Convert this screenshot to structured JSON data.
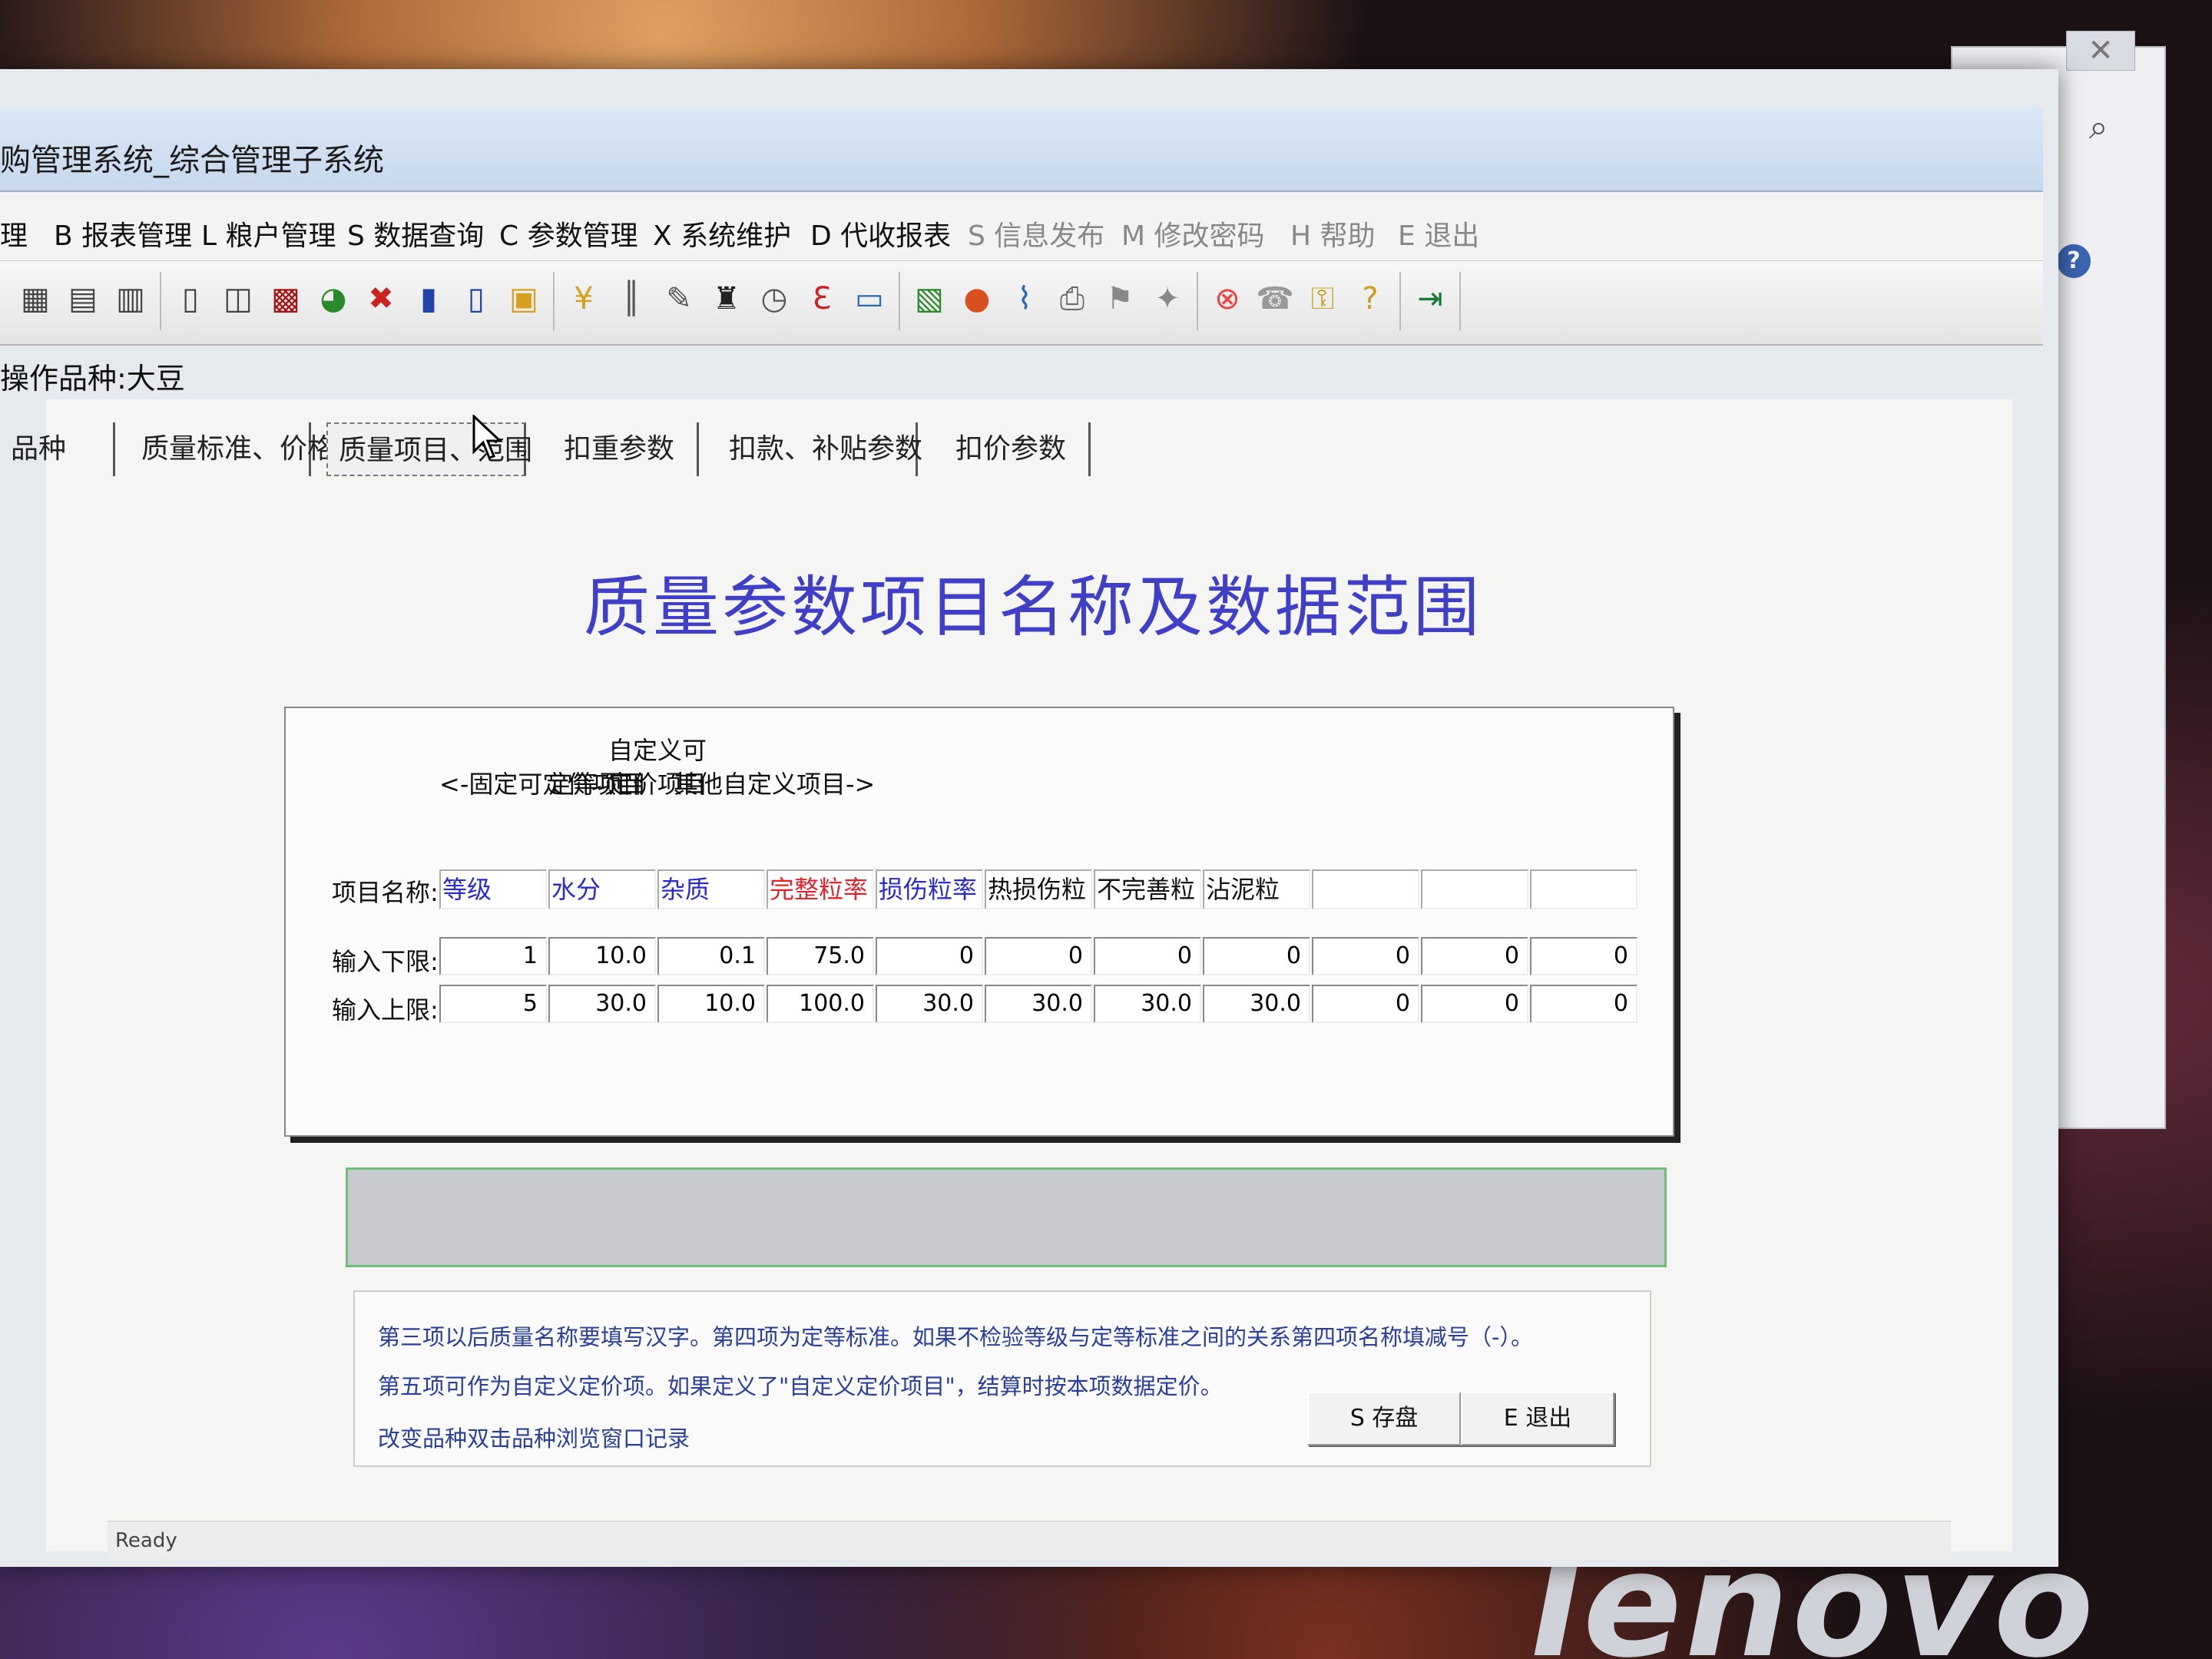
{
  "window": {
    "title": "购管理系统_综合管理子系统"
  },
  "menu": [
    {
      "label": "理",
      "dim": false
    },
    {
      "label": "B 报表管理",
      "dim": false
    },
    {
      "label": "L 粮户管理",
      "dim": false
    },
    {
      "label": "S 数据查询",
      "dim": false
    },
    {
      "label": "C 参数管理",
      "dim": false
    },
    {
      "label": "X 系统维护",
      "dim": false
    },
    {
      "label": "D 代收报表",
      "dim": false
    },
    {
      "label": "S 信息发布",
      "dim": true
    },
    {
      "label": "M 修改密码",
      "dim": true
    },
    {
      "label": "H 帮助",
      "dim": true
    },
    {
      "label": "E 退出",
      "dim": true
    }
  ],
  "toolbar_icons": [
    "grid-icon",
    "report-icon",
    "document-icon",
    "columns-icon",
    "layout-icon",
    "table-icon",
    "pie-chart-icon",
    "excel-icon",
    "bar-chart-icon",
    "bar-chart-2-icon",
    "image-icon",
    "money-icon",
    "barcode-icon",
    "tool-icon",
    "binoculars-icon",
    "clock-icon",
    "e-icon",
    "window-icon",
    "picture-icon",
    "group-icon",
    "chart-icon",
    "printer-icon",
    "flag-icon",
    "run-icon",
    "stop-icon",
    "phone-icon",
    "key-icon",
    "help-icon",
    "exit-icon"
  ],
  "operating_variety": "操作品种:大豆",
  "tabs": [
    {
      "label": "品种",
      "active": false
    },
    {
      "label": "质量标准、价格",
      "active": false
    },
    {
      "label": "质量项目、范围",
      "active": true
    },
    {
      "label": "扣重参数",
      "active": false
    },
    {
      "label": "扣款、补贴参数",
      "active": false
    },
    {
      "label": "扣价参数",
      "active": false
    }
  ],
  "heading": "质量参数项目名称及数据范围",
  "groups": {
    "fixed": "<-固定可定价项目",
    "grade": "定等项目",
    "custom_top": "自定义可",
    "custom_bottom": "定价项目",
    "others": "其他自定义项目->"
  },
  "labels": {
    "name": "项目名称:",
    "lower": "输入下限:",
    "upper": "输入上限:"
  },
  "items": [
    {
      "name": "等级",
      "color": "#2a2ad0",
      "lower": "1",
      "upper": "5"
    },
    {
      "name": "水分",
      "color": "#2a2ad0",
      "lower": "10.0",
      "upper": "30.0"
    },
    {
      "name": "杂质",
      "color": "#2a2ad0",
      "lower": "0.1",
      "upper": "10.0"
    },
    {
      "name": "完整粒率",
      "color": "#e0242a",
      "lower": "75.0",
      "upper": "100.0"
    },
    {
      "name": "损伤粒率",
      "color": "#2a2ad0",
      "lower": "0",
      "upper": "30.0"
    },
    {
      "name": "热损伤粒",
      "color": "#111111",
      "lower": "0",
      "upper": "30.0"
    },
    {
      "name": "不完善粒",
      "color": "#111111",
      "lower": "0",
      "upper": "30.0"
    },
    {
      "name": "沾泥粒",
      "color": "#111111",
      "lower": "0",
      "upper": "30.0"
    },
    {
      "name": "",
      "color": "#111111",
      "lower": "0",
      "upper": "0"
    },
    {
      "name": "",
      "color": "#111111",
      "lower": "0",
      "upper": "0"
    },
    {
      "name": "",
      "color": "#111111",
      "lower": "0",
      "upper": "0"
    }
  ],
  "notes": [
    "第三项以后质量名称要填写汉字。第四项为定等标准。如果不检验等级与定等标准之间的关系第四项名称填减号（-）。",
    "第五项可作为自定义定价项。如果定义了\"自定义定价项目\"，结算时按本项数据定价。",
    "改变品种双击品种浏览窗口记录"
  ],
  "buttons": {
    "save": "S 存盘",
    "exit": "E 退出"
  },
  "status": "Ready",
  "desktop_brand": "lenovo"
}
